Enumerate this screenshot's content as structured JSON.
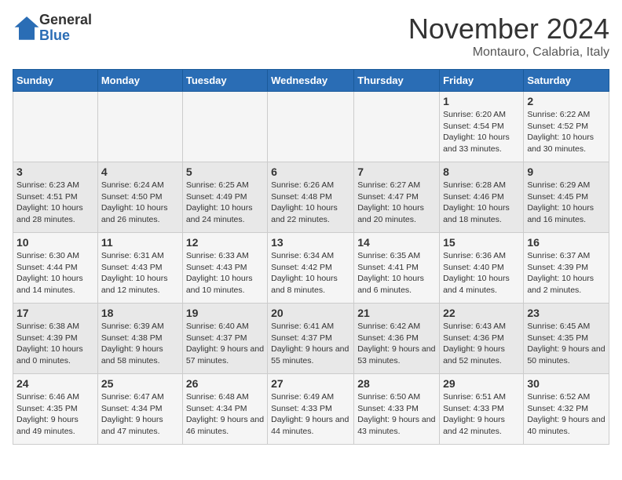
{
  "logo": {
    "general": "General",
    "blue": "Blue"
  },
  "title": "November 2024",
  "subtitle": "Montauro, Calabria, Italy",
  "days_of_week": [
    "Sunday",
    "Monday",
    "Tuesday",
    "Wednesday",
    "Thursday",
    "Friday",
    "Saturday"
  ],
  "weeks": [
    [
      {
        "day": "",
        "info": ""
      },
      {
        "day": "",
        "info": ""
      },
      {
        "day": "",
        "info": ""
      },
      {
        "day": "",
        "info": ""
      },
      {
        "day": "",
        "info": ""
      },
      {
        "day": "1",
        "info": "Sunrise: 6:20 AM\nSunset: 4:54 PM\nDaylight: 10 hours and 33 minutes."
      },
      {
        "day": "2",
        "info": "Sunrise: 6:22 AM\nSunset: 4:52 PM\nDaylight: 10 hours and 30 minutes."
      }
    ],
    [
      {
        "day": "3",
        "info": "Sunrise: 6:23 AM\nSunset: 4:51 PM\nDaylight: 10 hours and 28 minutes."
      },
      {
        "day": "4",
        "info": "Sunrise: 6:24 AM\nSunset: 4:50 PM\nDaylight: 10 hours and 26 minutes."
      },
      {
        "day": "5",
        "info": "Sunrise: 6:25 AM\nSunset: 4:49 PM\nDaylight: 10 hours and 24 minutes."
      },
      {
        "day": "6",
        "info": "Sunrise: 6:26 AM\nSunset: 4:48 PM\nDaylight: 10 hours and 22 minutes."
      },
      {
        "day": "7",
        "info": "Sunrise: 6:27 AM\nSunset: 4:47 PM\nDaylight: 10 hours and 20 minutes."
      },
      {
        "day": "8",
        "info": "Sunrise: 6:28 AM\nSunset: 4:46 PM\nDaylight: 10 hours and 18 minutes."
      },
      {
        "day": "9",
        "info": "Sunrise: 6:29 AM\nSunset: 4:45 PM\nDaylight: 10 hours and 16 minutes."
      }
    ],
    [
      {
        "day": "10",
        "info": "Sunrise: 6:30 AM\nSunset: 4:44 PM\nDaylight: 10 hours and 14 minutes."
      },
      {
        "day": "11",
        "info": "Sunrise: 6:31 AM\nSunset: 4:43 PM\nDaylight: 10 hours and 12 minutes."
      },
      {
        "day": "12",
        "info": "Sunrise: 6:33 AM\nSunset: 4:43 PM\nDaylight: 10 hours and 10 minutes."
      },
      {
        "day": "13",
        "info": "Sunrise: 6:34 AM\nSunset: 4:42 PM\nDaylight: 10 hours and 8 minutes."
      },
      {
        "day": "14",
        "info": "Sunrise: 6:35 AM\nSunset: 4:41 PM\nDaylight: 10 hours and 6 minutes."
      },
      {
        "day": "15",
        "info": "Sunrise: 6:36 AM\nSunset: 4:40 PM\nDaylight: 10 hours and 4 minutes."
      },
      {
        "day": "16",
        "info": "Sunrise: 6:37 AM\nSunset: 4:39 PM\nDaylight: 10 hours and 2 minutes."
      }
    ],
    [
      {
        "day": "17",
        "info": "Sunrise: 6:38 AM\nSunset: 4:39 PM\nDaylight: 10 hours and 0 minutes."
      },
      {
        "day": "18",
        "info": "Sunrise: 6:39 AM\nSunset: 4:38 PM\nDaylight: 9 hours and 58 minutes."
      },
      {
        "day": "19",
        "info": "Sunrise: 6:40 AM\nSunset: 4:37 PM\nDaylight: 9 hours and 57 minutes."
      },
      {
        "day": "20",
        "info": "Sunrise: 6:41 AM\nSunset: 4:37 PM\nDaylight: 9 hours and 55 minutes."
      },
      {
        "day": "21",
        "info": "Sunrise: 6:42 AM\nSunset: 4:36 PM\nDaylight: 9 hours and 53 minutes."
      },
      {
        "day": "22",
        "info": "Sunrise: 6:43 AM\nSunset: 4:36 PM\nDaylight: 9 hours and 52 minutes."
      },
      {
        "day": "23",
        "info": "Sunrise: 6:45 AM\nSunset: 4:35 PM\nDaylight: 9 hours and 50 minutes."
      }
    ],
    [
      {
        "day": "24",
        "info": "Sunrise: 6:46 AM\nSunset: 4:35 PM\nDaylight: 9 hours and 49 minutes."
      },
      {
        "day": "25",
        "info": "Sunrise: 6:47 AM\nSunset: 4:34 PM\nDaylight: 9 hours and 47 minutes."
      },
      {
        "day": "26",
        "info": "Sunrise: 6:48 AM\nSunset: 4:34 PM\nDaylight: 9 hours and 46 minutes."
      },
      {
        "day": "27",
        "info": "Sunrise: 6:49 AM\nSunset: 4:33 PM\nDaylight: 9 hours and 44 minutes."
      },
      {
        "day": "28",
        "info": "Sunrise: 6:50 AM\nSunset: 4:33 PM\nDaylight: 9 hours and 43 minutes."
      },
      {
        "day": "29",
        "info": "Sunrise: 6:51 AM\nSunset: 4:33 PM\nDaylight: 9 hours and 42 minutes."
      },
      {
        "day": "30",
        "info": "Sunrise: 6:52 AM\nSunset: 4:32 PM\nDaylight: 9 hours and 40 minutes."
      }
    ]
  ]
}
